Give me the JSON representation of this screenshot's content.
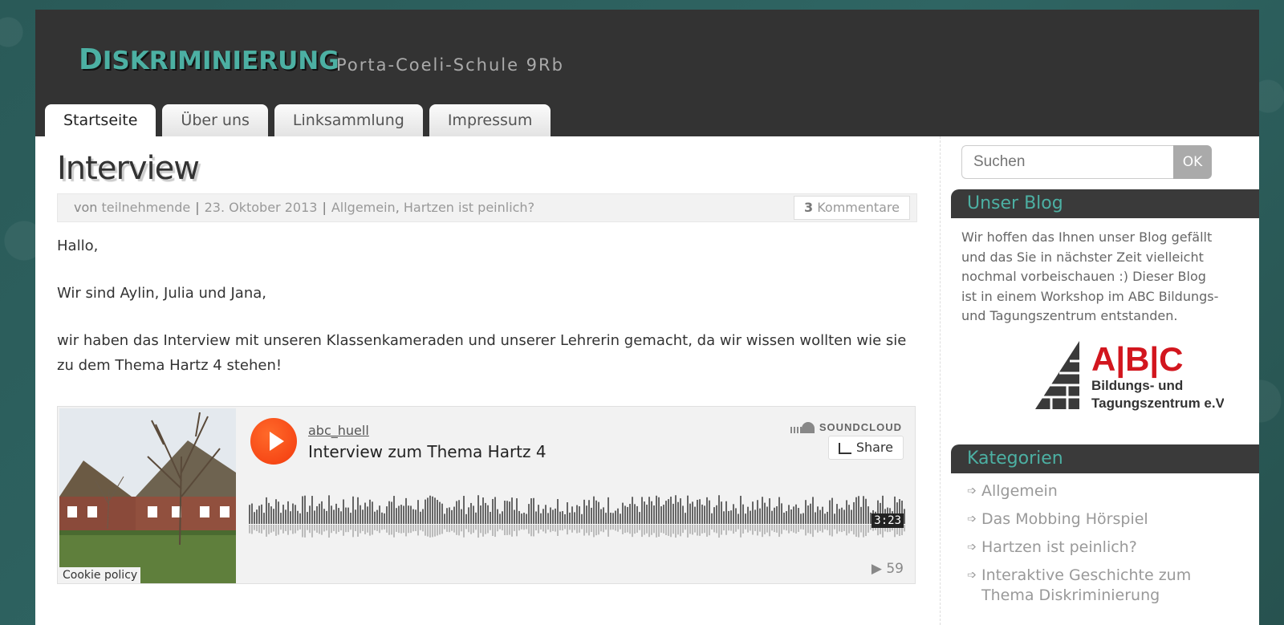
{
  "header": {
    "site_title_first": "D",
    "site_title_rest": "ISKRIMINIERUNG",
    "site_description": "Porta-Coeli-Schule 9Rb"
  },
  "nav": {
    "tabs": [
      {
        "label": "Startseite"
      },
      {
        "label": "Über uns"
      },
      {
        "label": "Linksammlung"
      },
      {
        "label": "Impressum"
      }
    ]
  },
  "post": {
    "title": "Interview",
    "meta": {
      "by": "von",
      "author": "teilnehmende",
      "date": "23. Oktober 2013",
      "category1": "Allgemein",
      "category2": "Hartzen ist peinlich?",
      "comment_count": "3",
      "comment_label": "Kommentare"
    },
    "paragraphs": [
      "Hallo,",
      "Wir sind Aylin, Julia und Jana,",
      "wir haben das Interview mit unseren Klassenkameraden und unserer Lehrerin gemacht, da wir wissen wollten wie sie zu dem Thema Hartz 4 stehen!"
    ]
  },
  "player": {
    "username": "abc_huell",
    "track_title": "Interview zum Thema Hartz 4",
    "brand": "SOUNDCLOUD",
    "share_label": "Share",
    "duration": "3:23",
    "play_count": "59",
    "cookie_label": "Cookie policy",
    "icons": [
      "play-icon",
      "soundcloud-icon",
      "share-icon",
      "play-count-icon"
    ]
  },
  "sidebar": {
    "search_placeholder": "Suchen",
    "search_button": "OK",
    "blog_widget_title": "Unser Blog",
    "blog_text": "Wir hoffen das Ihnen unser Blog gefällt und das Sie in nächster Zeit vielleicht nochmal vorbeischauen :) Dieser Blog ist in einem Workshop im ABC Bildungs- und Tagungszentrum entstanden.",
    "logo": {
      "letters": "A|B|C",
      "line1": "Bildungs- und",
      "line2": "Tagungszentrum e.V."
    },
    "categories_title": "Kategorien",
    "categories": [
      {
        "label": "Allgemein"
      },
      {
        "label": "Das Mobbing Hörspiel"
      },
      {
        "label": "Hartzen ist peinlich?"
      },
      {
        "label": "Interaktive Geschichte zum Thema Diskriminierung"
      }
    ]
  },
  "colors": {
    "accent": "#4cb0a3",
    "header_bg": "#333333",
    "soundcloud_orange": "#f33a0e",
    "logo_red": "#d2161e"
  }
}
